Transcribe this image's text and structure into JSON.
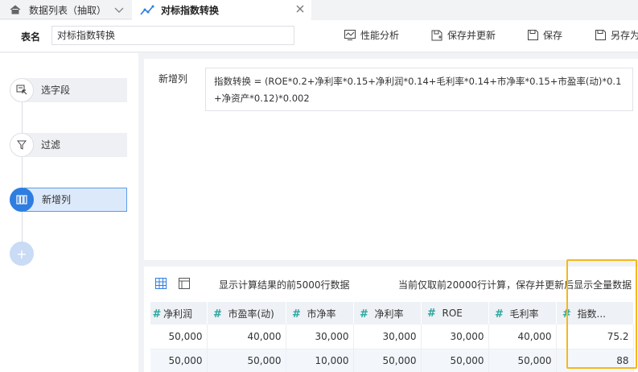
{
  "tabs": {
    "tab1_label": "数据列表（抽取）",
    "tab2_label": "对标指数转换"
  },
  "header": {
    "name_label": "表名",
    "name_value": "对标指数转换",
    "perf_label": "性能分析",
    "save_update_label": "保存并更新",
    "save_label": "保存",
    "save_as_label": "另存为"
  },
  "pipeline": {
    "steps": [
      {
        "label": "选字段",
        "icon": "select-field-icon"
      },
      {
        "label": "过滤",
        "icon": "filter-icon"
      },
      {
        "label": "新增列",
        "icon": "add-column-icon",
        "active": true
      }
    ],
    "add_label": "+"
  },
  "formula": {
    "label": "新增列",
    "text": "指数转换 = (ROE*0.2+净利率*0.15+净利润*0.14+毛利率*0.14+市净率*0.15+市盈率(动)*0.1+净资产*0.12)*0.002"
  },
  "data": {
    "note": "显示计算结果的前5000行数据",
    "right_note": "当前仅取前20000行计算，保存并更新后显示全量数据",
    "columns": [
      "净利润",
      "市盈率(动)",
      "市净率",
      "净利率",
      "ROE",
      "毛利率",
      "指数..."
    ],
    "rows": [
      [
        "50,000",
        "40,000",
        "30,000",
        "30,000",
        "30,000",
        "40,000",
        "75.2"
      ],
      [
        "50,000",
        "50,000",
        "10,000",
        "50,000",
        "50,000",
        "50,000",
        "88"
      ]
    ]
  },
  "colors": {
    "accent": "#2e7de1",
    "hash": "#2aa7a0",
    "highlight": "#f5b81a"
  }
}
